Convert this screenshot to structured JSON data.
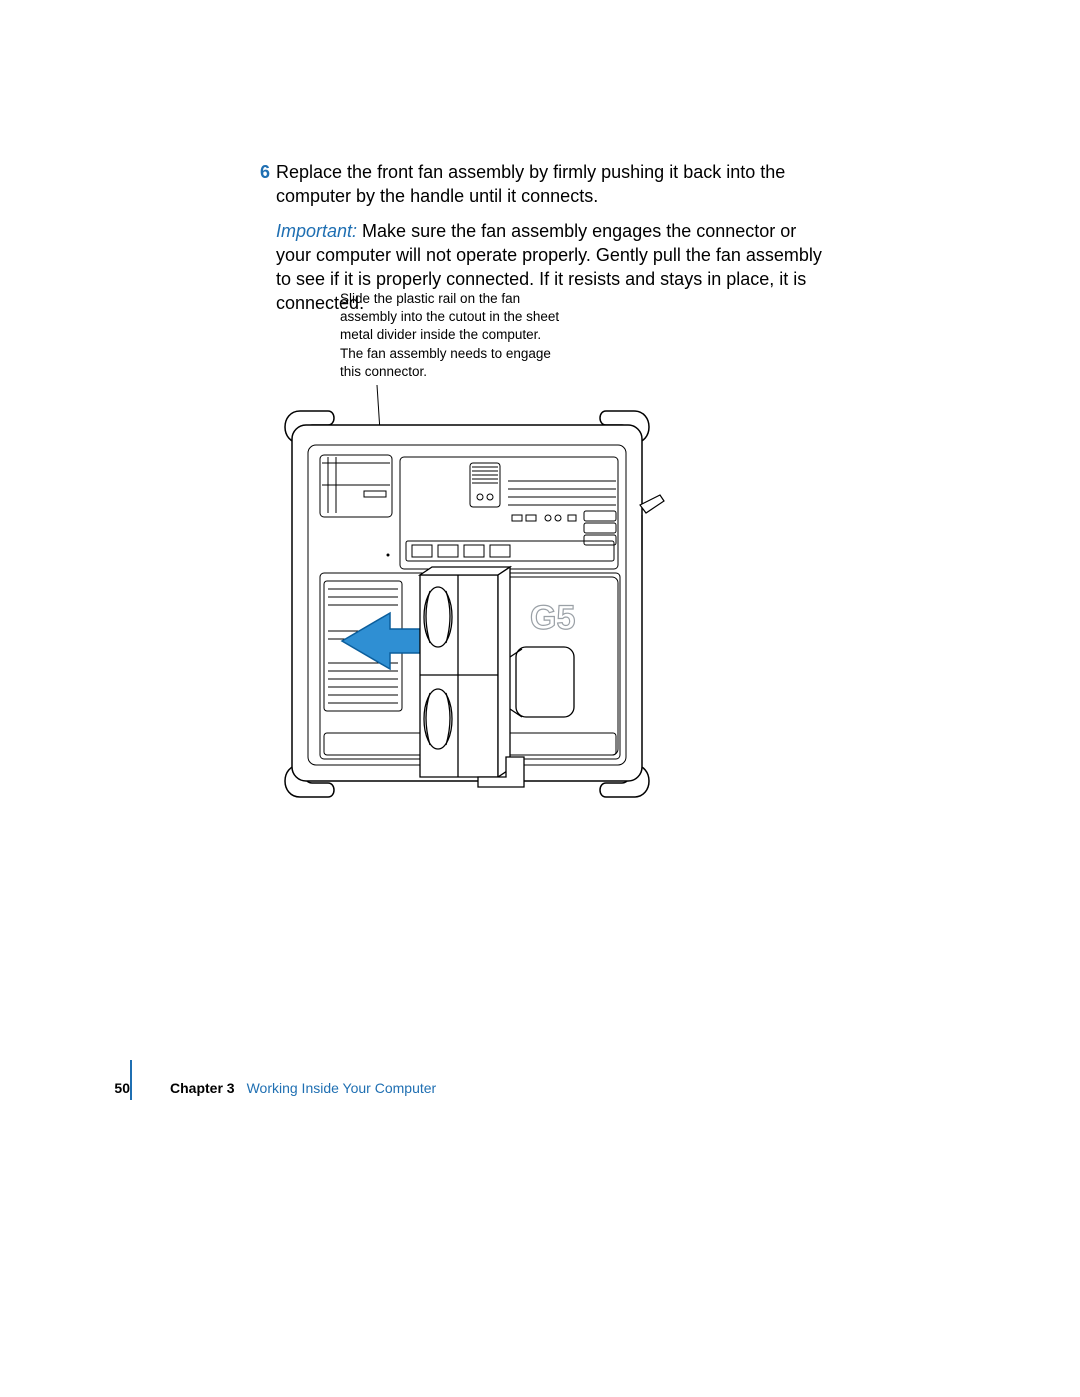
{
  "step": {
    "number": "6",
    "text": "Replace the front fan assembly by firmly pushing it back into the computer by the handle until it connects."
  },
  "important": {
    "label": "Important:",
    "text": " Make sure the fan assembly engages the connector or your computer will not operate properly. Gently pull the fan assembly to see if it is properly connected. If it resists and stays in place, it is connected."
  },
  "callout": {
    "text": "Slide the plastic rail on the fan assembly into the cutout in the sheet metal divider inside the computer. The fan assembly needs to engage this connector."
  },
  "diagram": {
    "label": "G5"
  },
  "footer": {
    "page": "50",
    "chapter_label": "Chapter 3",
    "chapter_title": "Working Inside Your Computer"
  }
}
